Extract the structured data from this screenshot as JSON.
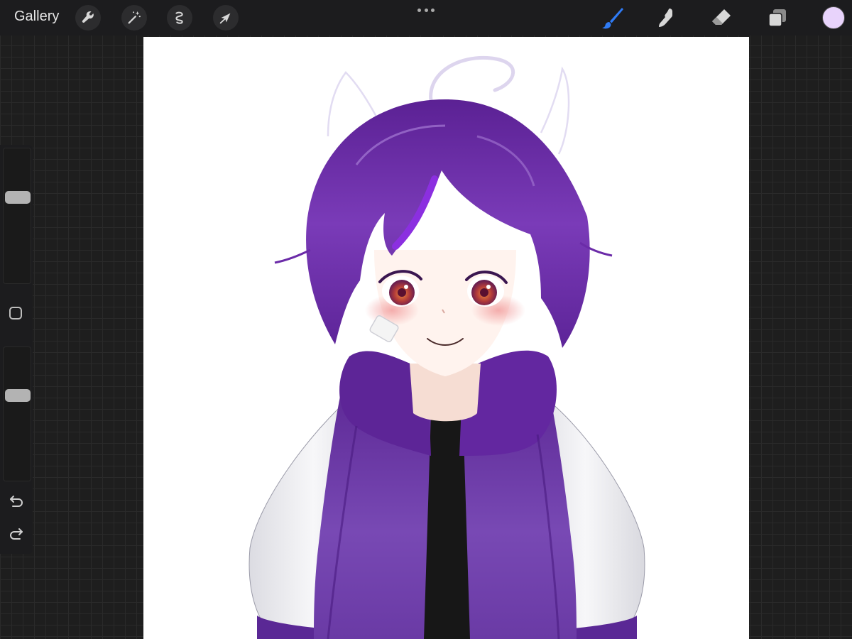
{
  "topbar": {
    "gallery_label": "Gallery",
    "left_tools": [
      "wrench-icon",
      "magic-wand-icon",
      "selection-icon",
      "transform-arrow-icon"
    ],
    "right_tools": [
      "brush-icon",
      "smudge-icon",
      "eraser-icon",
      "layers-icon"
    ],
    "active_tool": "brush-icon",
    "active_tool_color": "#2f7bf5",
    "current_color": "#e8d3fb"
  },
  "sidebar": {
    "brush_size_level": 0.35,
    "opacity_level": 0.35,
    "controls": [
      "modifier-square-icon",
      "undo-icon",
      "redo-icon"
    ]
  },
  "canvas": {
    "artwork": "anime-character-purple-hair-illustration",
    "background": "#ffffff"
  },
  "colors": {
    "hair": "#6a2da4",
    "hoodie": "#6b3aa8",
    "sleeves": "#f2f2f4",
    "shirt": "#161616",
    "eyes": "#c2532a"
  }
}
